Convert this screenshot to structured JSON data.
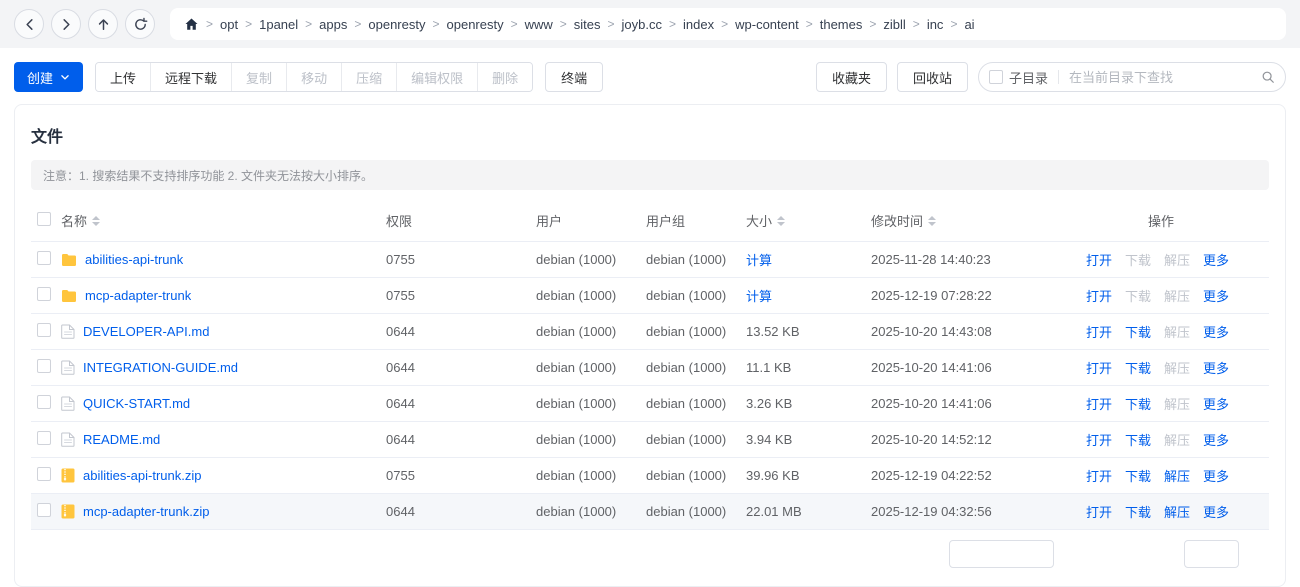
{
  "breadcrumb": {
    "separator": ">",
    "items": [
      "opt",
      "1panel",
      "apps",
      "openresty",
      "openresty",
      "www",
      "sites",
      "joyb.cc",
      "index",
      "wp-content",
      "themes",
      "zibll",
      "inc",
      "ai"
    ]
  },
  "toolbar": {
    "create_label": "创建",
    "group_buttons": [
      {
        "name": "upload-button",
        "label": "上传",
        "enabled": true
      },
      {
        "name": "remote-download-button",
        "label": "远程下载",
        "enabled": true
      },
      {
        "name": "copy-button",
        "label": "复制",
        "enabled": false
      },
      {
        "name": "move-button",
        "label": "移动",
        "enabled": false
      },
      {
        "name": "compress-button",
        "label": "压缩",
        "enabled": false
      },
      {
        "name": "edit-permission-button",
        "label": "编辑权限",
        "enabled": false
      },
      {
        "name": "delete-button",
        "label": "删除",
        "enabled": false
      }
    ],
    "terminal_label": "终端",
    "favorites_label": "收藏夹",
    "recycle_bin_label": "回收站",
    "subdirectory_label": "子目录",
    "search_placeholder": "在当前目录下查找"
  },
  "page": {
    "title": "文件",
    "notice": "注意：1. 搜索结果不支持排序功能 2. 文件夹无法按大小排序。"
  },
  "table": {
    "headers": {
      "name": "名称",
      "permission": "权限",
      "user": "用户",
      "group": "用户组",
      "size": "大小",
      "modified": "修改时间",
      "actions": "操作"
    },
    "action_labels": [
      "打开",
      "下载",
      "解压",
      "更多"
    ],
    "rows": [
      {
        "name": "abilities-api-trunk",
        "icon": "folder",
        "permission": "0755",
        "user": "debian (1000)",
        "group": "debian (1000)",
        "size": "计算",
        "size_is_link": true,
        "modified": "2025-11-28 14:40:23",
        "actions": {
          "open": true,
          "download": false,
          "unzip": false,
          "more": true
        }
      },
      {
        "name": "mcp-adapter-trunk",
        "icon": "folder",
        "permission": "0755",
        "user": "debian (1000)",
        "group": "debian (1000)",
        "size": "计算",
        "size_is_link": true,
        "modified": "2025-12-19 07:28:22",
        "actions": {
          "open": true,
          "download": false,
          "unzip": false,
          "more": true
        }
      },
      {
        "name": "DEVELOPER-API.md",
        "icon": "file",
        "permission": "0644",
        "user": "debian (1000)",
        "group": "debian (1000)",
        "size": "13.52 KB",
        "size_is_link": false,
        "modified": "2025-10-20 14:43:08",
        "actions": {
          "open": true,
          "download": true,
          "unzip": false,
          "more": true
        }
      },
      {
        "name": "INTEGRATION-GUIDE.md",
        "icon": "file",
        "permission": "0644",
        "user": "debian (1000)",
        "group": "debian (1000)",
        "size": "11.1 KB",
        "size_is_link": false,
        "modified": "2025-10-20 14:41:06",
        "actions": {
          "open": true,
          "download": true,
          "unzip": false,
          "more": true
        }
      },
      {
        "name": "QUICK-START.md",
        "icon": "file",
        "permission": "0644",
        "user": "debian (1000)",
        "group": "debian (1000)",
        "size": "3.26 KB",
        "size_is_link": false,
        "modified": "2025-10-20 14:41:06",
        "actions": {
          "open": true,
          "download": true,
          "unzip": false,
          "more": true
        }
      },
      {
        "name": "README.md",
        "icon": "file",
        "permission": "0644",
        "user": "debian (1000)",
        "group": "debian (1000)",
        "size": "3.94 KB",
        "size_is_link": false,
        "modified": "2025-10-20 14:52:12",
        "actions": {
          "open": true,
          "download": true,
          "unzip": false,
          "more": true
        }
      },
      {
        "name": "abilities-api-trunk.zip",
        "icon": "zip",
        "permission": "0755",
        "user": "debian (1000)",
        "group": "debian (1000)",
        "size": "39.96 KB",
        "size_is_link": false,
        "modified": "2025-12-19 04:22:52",
        "actions": {
          "open": true,
          "download": true,
          "unzip": true,
          "more": true
        }
      },
      {
        "name": "mcp-adapter-trunk.zip",
        "icon": "zip",
        "permission": "0644",
        "user": "debian (1000)",
        "group": "debian (1000)",
        "size": "22.01 MB",
        "size_is_link": false,
        "modified": "2025-12-19 04:32:56",
        "actions": {
          "open": true,
          "download": true,
          "unzip": true,
          "more": true
        },
        "hovered": true
      }
    ]
  },
  "colors": {
    "primary": "#005eeb",
    "folder_icon": "#ffc53d",
    "disabled_text": "#c0c4cc"
  }
}
